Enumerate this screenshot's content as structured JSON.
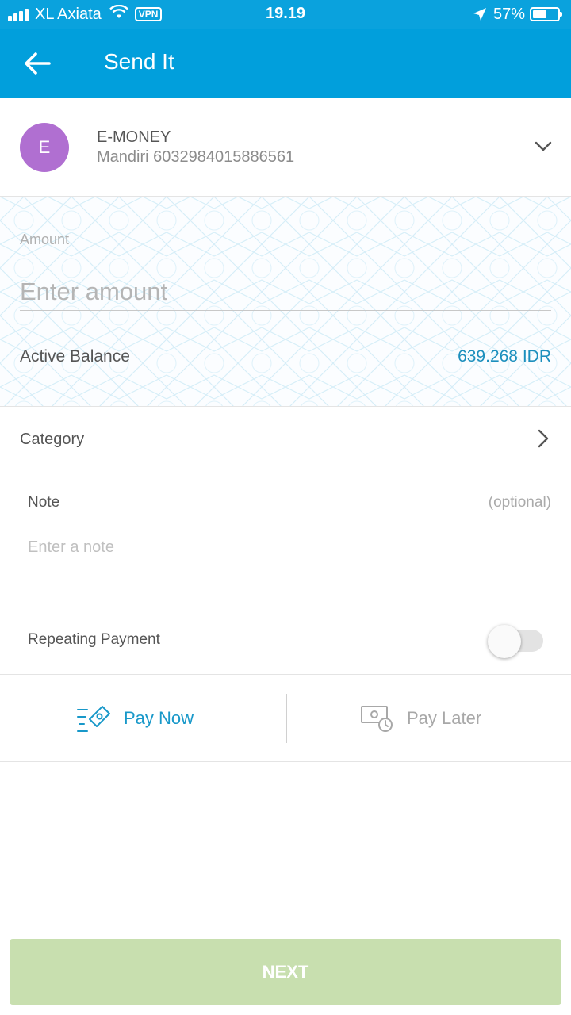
{
  "status_bar": {
    "carrier": "XL Axiata",
    "vpn": "VPN",
    "time": "19.19",
    "battery_percent": "57%",
    "battery_level": 0.57
  },
  "header": {
    "title": "Send It"
  },
  "account": {
    "avatar_letter": "E",
    "avatar_color": "#b06fd1",
    "name": "E-MONEY",
    "number": "Mandiri 6032984015886561"
  },
  "amount": {
    "label": "Amount",
    "placeholder": "Enter amount",
    "balance_label": "Active Balance",
    "balance_value": "639.268 IDR"
  },
  "category": {
    "label": "Category"
  },
  "note": {
    "label": "Note",
    "optional": "(optional)",
    "placeholder": "Enter a note"
  },
  "repeating": {
    "label": "Repeating Payment",
    "enabled": false
  },
  "pay_options": {
    "now": "Pay Now",
    "later": "Pay Later",
    "selected": "now"
  },
  "next_button": {
    "label": "NEXT"
  },
  "colors": {
    "header": "#019fdc",
    "accent": "#1898c9",
    "next_disabled": "#c8dfaf"
  }
}
